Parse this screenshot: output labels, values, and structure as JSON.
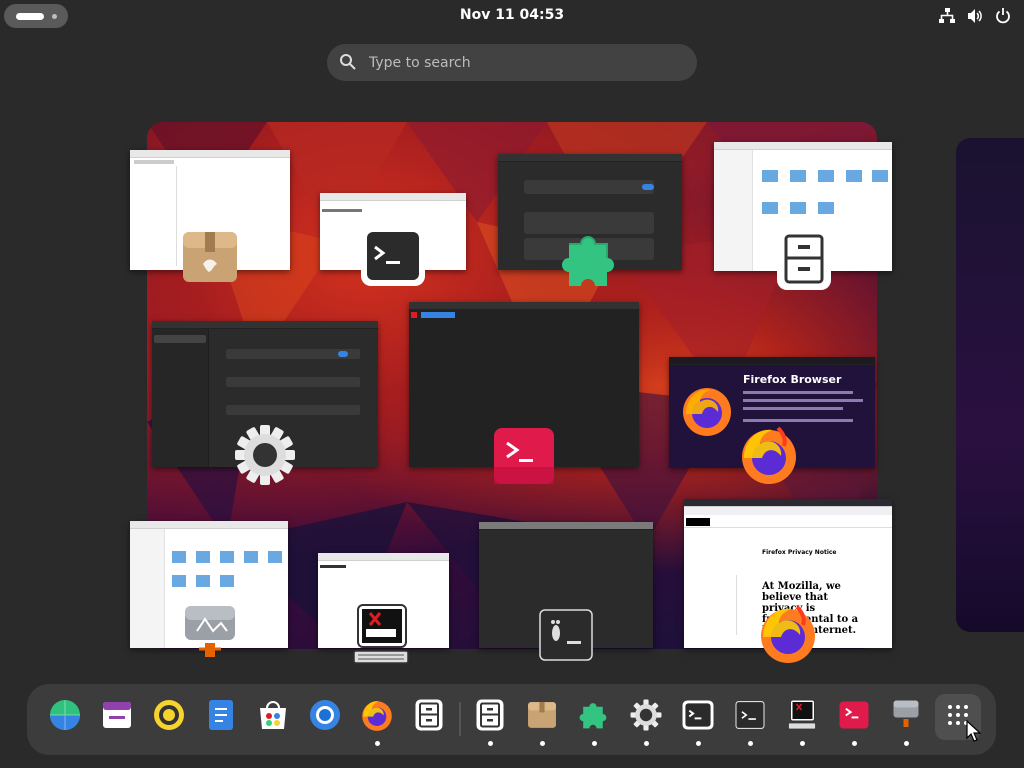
{
  "top_bar": {
    "clock": "Nov 11  04:53",
    "icons": [
      "network-icon",
      "volume-icon",
      "power-icon"
    ]
  },
  "search": {
    "placeholder": "Type to search"
  },
  "windows": [
    {
      "id": "archive-manager",
      "icon": "archive-manager-icon"
    },
    {
      "id": "terminal-small",
      "icon": "terminal-icon"
    },
    {
      "id": "extensions",
      "icon": "extensions-icon"
    },
    {
      "id": "files-top",
      "icon": "files-icon"
    },
    {
      "id": "settings",
      "icon": "settings-icon"
    },
    {
      "id": "console",
      "icon": "console-icon"
    },
    {
      "id": "firefox-about",
      "icon": "firefox-icon"
    },
    {
      "id": "files-bottom",
      "icon": "image-viewer-icon"
    },
    {
      "id": "xterm",
      "icon": "xterm-icon"
    },
    {
      "id": "foot-terminal",
      "icon": "foot-terminal-icon"
    },
    {
      "id": "firefox-privacy",
      "icon": "firefox-icon"
    }
  ],
  "firefox_about": {
    "title": "Firefox Browser"
  },
  "firefox_privacy": {
    "heading": "Firefox Privacy Notice",
    "headline": "At Mozilla, we believe that privacy is fundamental to a healthy internet."
  },
  "dock": {
    "items": [
      {
        "name": "globe-icon",
        "running": false
      },
      {
        "name": "calendar-icon",
        "running": false
      },
      {
        "name": "rhythmbox-icon",
        "running": false
      },
      {
        "name": "document-viewer-icon",
        "running": false
      },
      {
        "name": "software-icon",
        "running": false
      },
      {
        "name": "chrome-icon",
        "running": false
      },
      {
        "name": "firefox-icon",
        "running": true
      },
      {
        "name": "files-icon",
        "running": false
      },
      {
        "name": "files-icon",
        "running": true
      },
      {
        "name": "archive-manager-icon",
        "running": true
      },
      {
        "name": "extensions-icon",
        "running": true
      },
      {
        "name": "settings-icon",
        "running": true
      },
      {
        "name": "terminal-icon",
        "running": true
      },
      {
        "name": "console-icon",
        "running": true
      },
      {
        "name": "xterm-icon",
        "running": true
      },
      {
        "name": "console-red-icon",
        "running": true
      },
      {
        "name": "image-viewer-icon",
        "running": true
      },
      {
        "name": "app-grid-icon",
        "running": false
      }
    ]
  },
  "colors": {
    "background": "#2a2a2a",
    "dock": "#3c3c3c",
    "search": "#424242"
  }
}
